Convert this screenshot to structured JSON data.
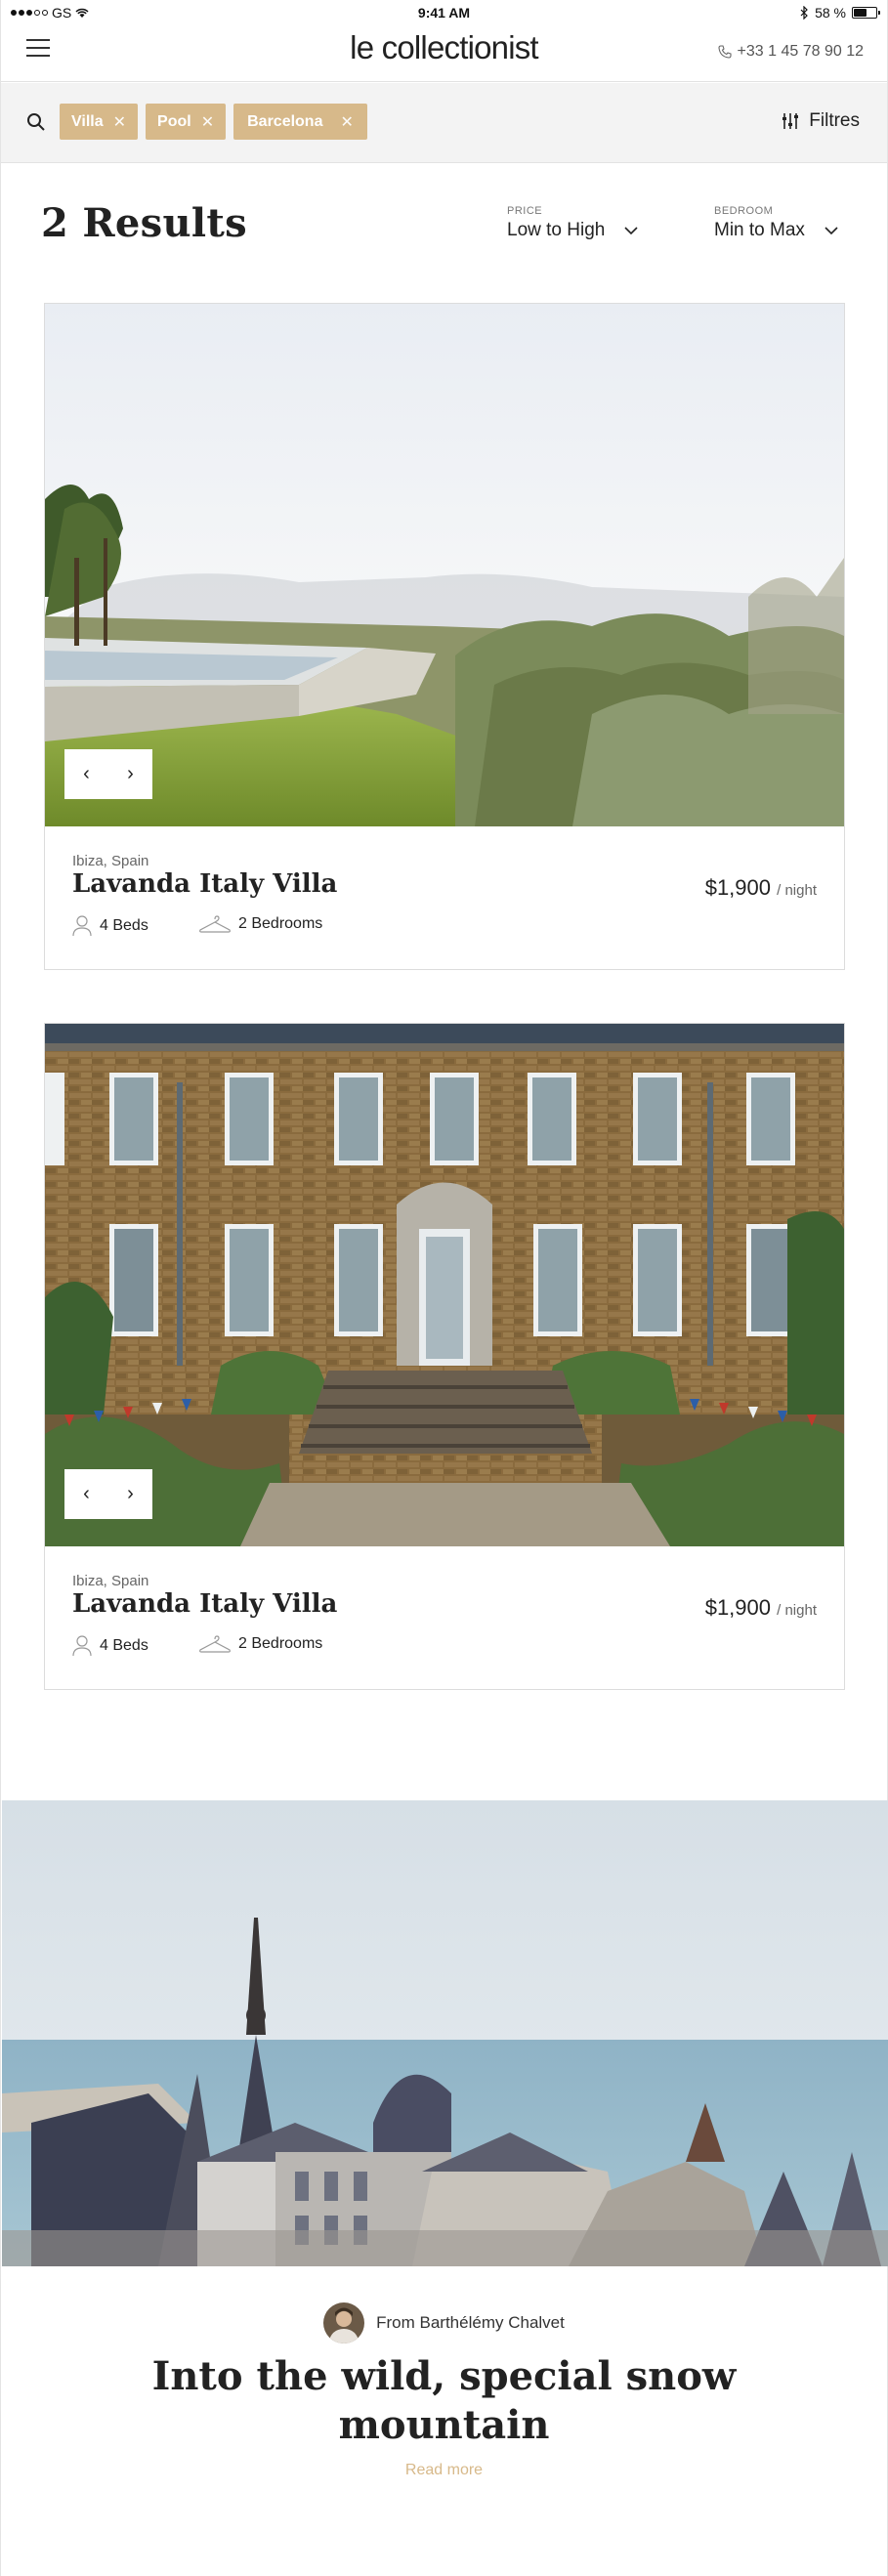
{
  "status_bar": {
    "carrier": "GS",
    "time": "9:41 AM",
    "battery": "58 %",
    "battery_level": 0.58
  },
  "header": {
    "logo": "le collectionist",
    "phone": "+33 1 45 78 90 12"
  },
  "filters": {
    "chips": [
      {
        "label": "Villa"
      },
      {
        "label": "Pool"
      },
      {
        "label": "Barcelona"
      }
    ],
    "filter_button": "Filtres"
  },
  "results": {
    "title": "2 Results",
    "price_sort": {
      "label": "PRICE",
      "value": "Low to High"
    },
    "bedroom_sort": {
      "label": "BEDROOM",
      "value": "Min to Max"
    }
  },
  "listings": [
    {
      "location": "Ibiza, Spain",
      "name": "Lavanda Italy Villa",
      "price": "$1,900",
      "per": "/ night",
      "beds": "4 Beds",
      "bedrooms": "2 Bedrooms"
    },
    {
      "location": "Ibiza, Spain",
      "name": "Lavanda Italy Villa",
      "price": "$1,900",
      "per": "/ night",
      "beds": "4 Beds",
      "bedrooms": "2 Bedrooms"
    }
  ],
  "blog": {
    "author": "From Barthélémy Chalvet",
    "title": "Into the wild, special snow mountain",
    "read_more": "Read more"
  },
  "colors": {
    "accent": "#d7b98a",
    "text": "#222222",
    "filter_bg": "#f3f3f3"
  }
}
